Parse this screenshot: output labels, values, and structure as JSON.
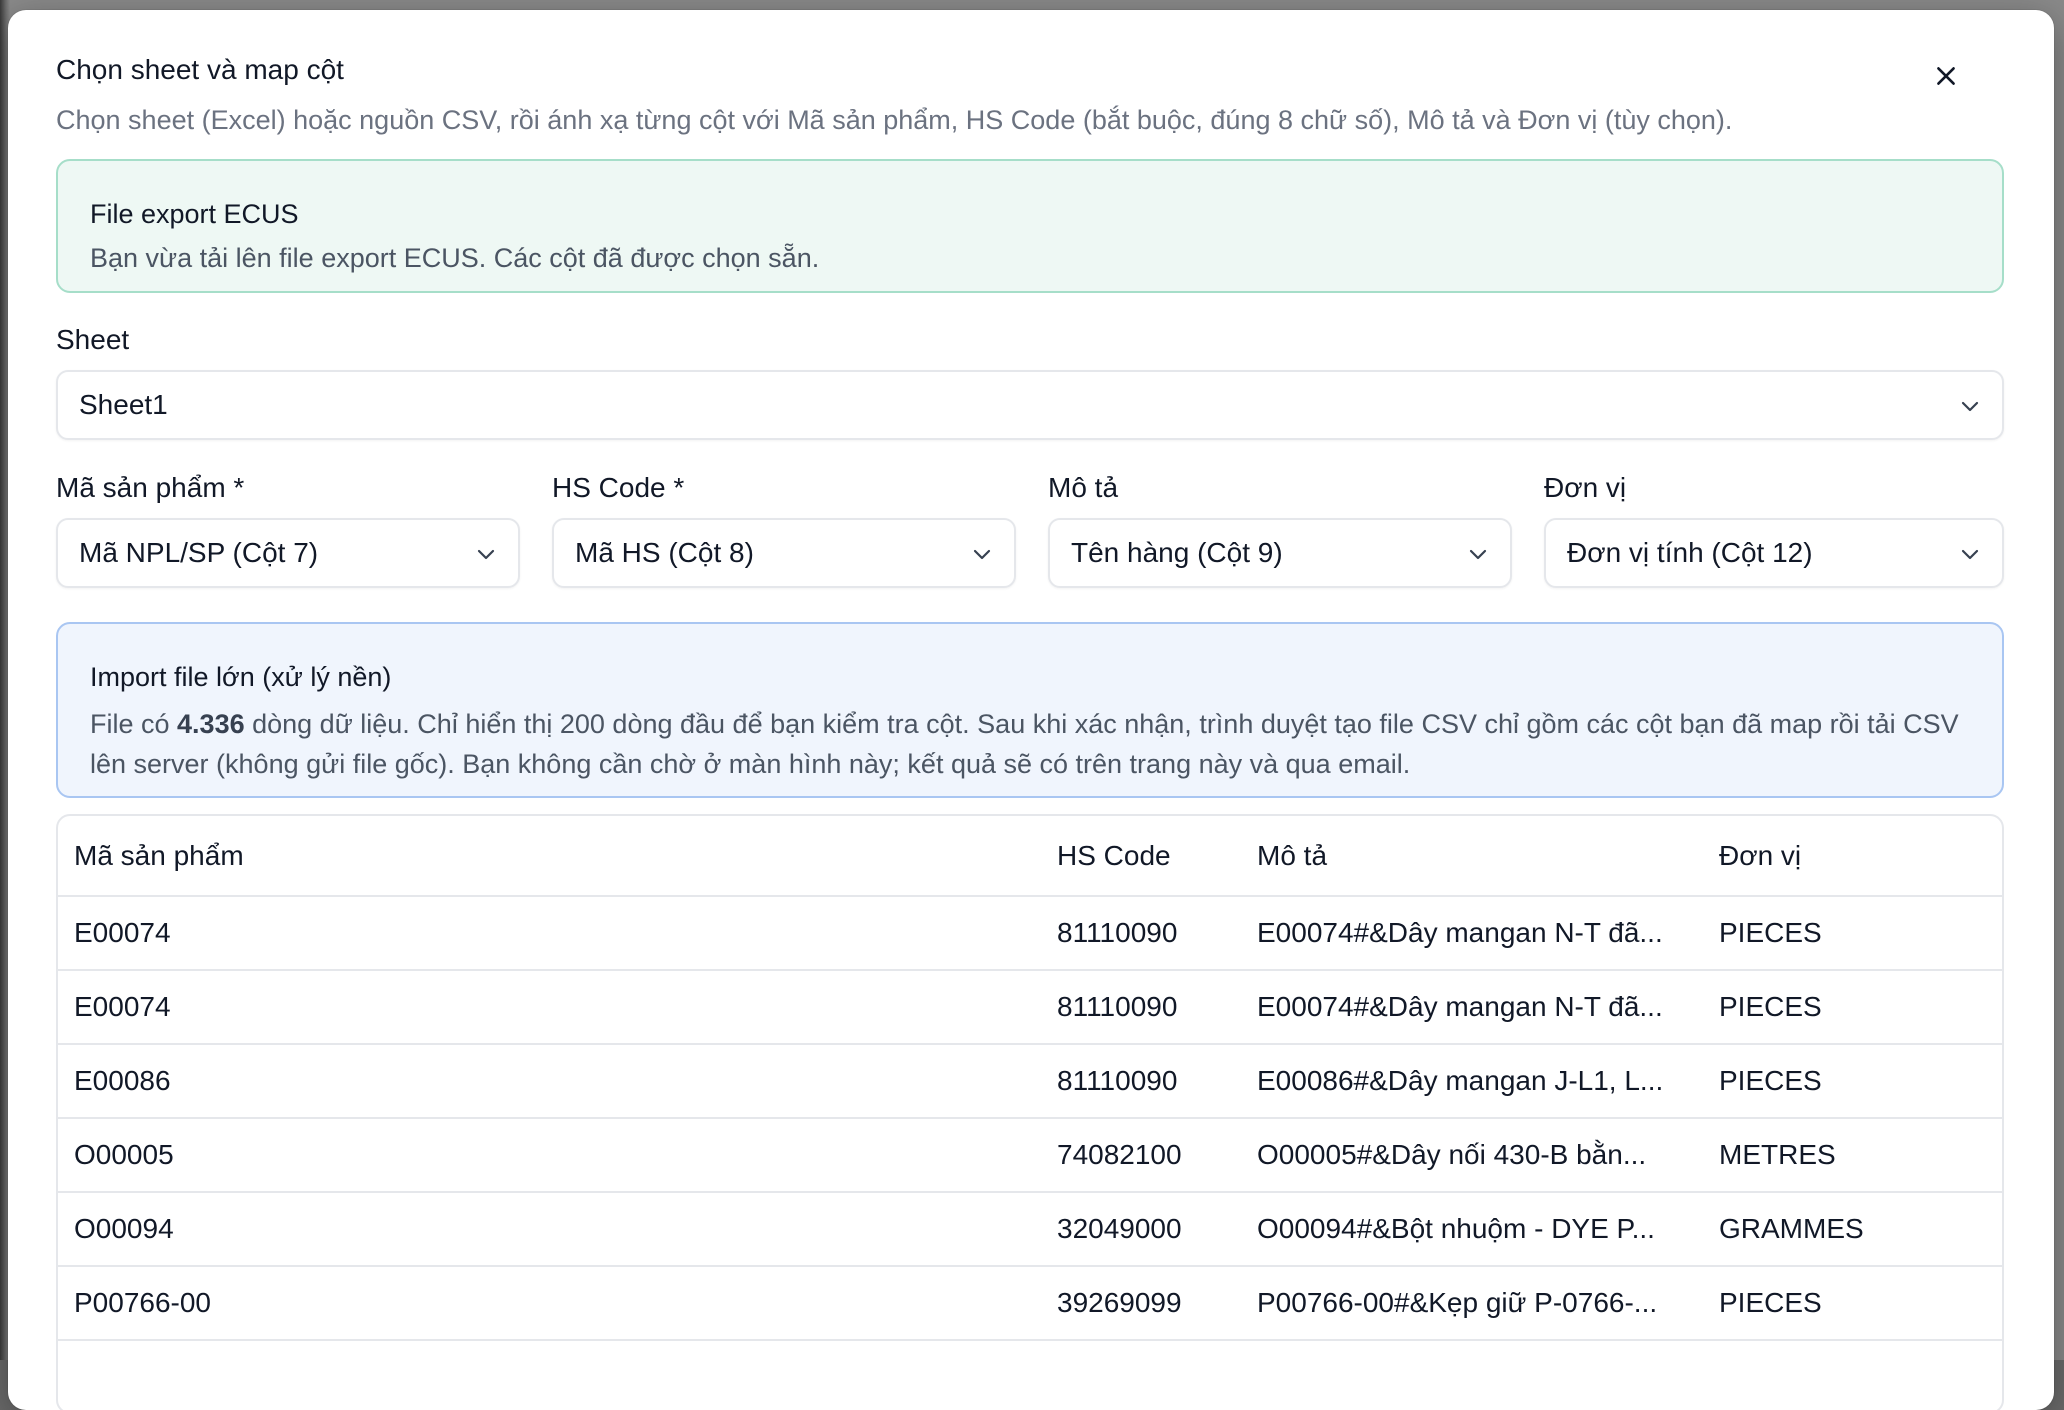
{
  "dialog": {
    "title": "Chọn sheet và map cột",
    "subtitle": "Chọn sheet (Excel) hoặc nguồn CSV, rồi ánh xạ từng cột với Mã sản phẩm, HS Code (bắt buộc, đúng 8 chữ số), Mô tả và Đơn vị (tùy chọn).",
    "close_icon": "close-icon"
  },
  "ecus_notice": {
    "title": "File export ECUS",
    "text": "Bạn vừa tải lên file export ECUS. Các cột đã được chọn sẵn."
  },
  "sheet": {
    "label": "Sheet",
    "value": "Sheet1"
  },
  "mappings": {
    "product_code": {
      "label": "Mã sản phẩm *",
      "value": "Mã NPL/SP (Cột 7)"
    },
    "hs_code": {
      "label": "HS Code *",
      "value": "Mã HS (Cột 8)"
    },
    "description": {
      "label": "Mô tả",
      "value": "Tên hàng (Cột 9)"
    },
    "unit": {
      "label": "Đơn vị",
      "value": "Đơn vị tính (Cột 12)"
    }
  },
  "import_notice": {
    "title": "Import file lớn (xử lý nền)",
    "text_before": "File có ",
    "row_count": "4.336",
    "text_after": " dòng dữ liệu. Chỉ hiển thị 200 dòng đầu để bạn kiểm tra cột. Sau khi xác nhận, trình duyệt tạo file CSV chỉ gồm các cột bạn đã map rồi tải CSV lên server (không gửi file gốc). Bạn không cần chờ ở màn hình này; kết quả sẽ có trên trang này và qua email."
  },
  "preview_table": {
    "headers": [
      "Mã sản phẩm",
      "HS Code",
      "Mô tả",
      "Đơn vị"
    ],
    "rows": [
      [
        "E00074",
        "81110090",
        "E00074#&Dây mangan N-T đã...",
        "PIECES"
      ],
      [
        "E00074",
        "81110090",
        "E00074#&Dây mangan N-T đã...",
        "PIECES"
      ],
      [
        "E00086",
        "81110090",
        "E00086#&Dây mangan J-L1, L...",
        "PIECES"
      ],
      [
        "O00005",
        "74082100",
        "O00005#&Dây nối 430-B bằn...",
        "METRES"
      ],
      [
        "O00094",
        "32049000",
        "O00094#&Bột nhuộm - DYE P...",
        "GRAMMES"
      ],
      [
        "P00766-00",
        "39269099",
        "P00766-00#&Kẹp giữ P-0766-...",
        "PIECES"
      ]
    ]
  },
  "colors": {
    "ecus_bg": "#eef8f4",
    "ecus_border": "#a6dec9",
    "import_bg": "#f0f5fd",
    "import_border": "#a9c6f2"
  }
}
